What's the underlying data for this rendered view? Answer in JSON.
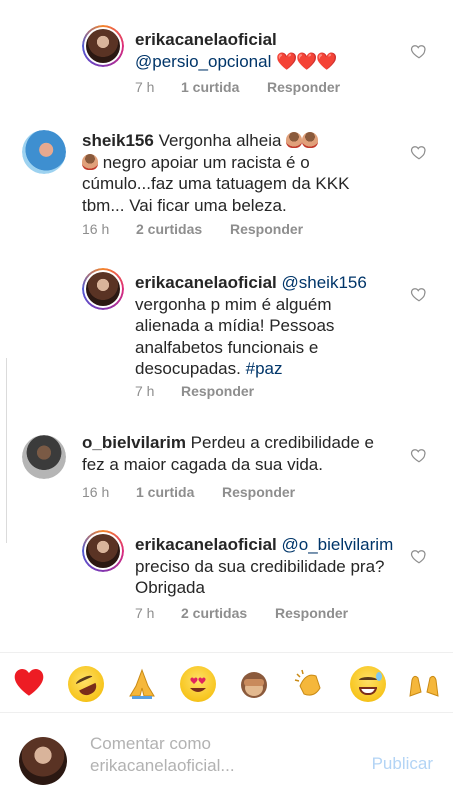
{
  "comments": [
    {
      "user": "erikacanelaoficial",
      "mention": "@persio_opcional",
      "hearts": "❤️❤️❤️",
      "time": "7 h",
      "likes": "1 curtida",
      "reply": "Responder"
    },
    {
      "user": "sheik156",
      "text_a": " Vergonha alheia ",
      "text_b": " negro apoiar um racista é o cúmulo...faz uma tatuagem da KKK tbm... Vai ficar uma beleza.",
      "time": "16 h",
      "likes": "2 curtidas",
      "reply": "Responder"
    },
    {
      "user": "erikacanelaoficial",
      "mention": "@sheik156",
      "text": "vergonha p mim é alguém alienada a mídia! Pessoas analfabetos funcionais e desocupadas.",
      "hashtag": "#paz",
      "time": "7 h",
      "reply": "Responder"
    },
    {
      "user": "o_bielvilarim",
      "text": " Perdeu a credibilidade e fez a maior cagada da sua vida.",
      "time": "16 h",
      "likes": "1 curtida",
      "reply": "Responder"
    },
    {
      "user": "erikacanelaoficial",
      "mention": "@o_bielvilarim",
      "text": "preciso da sua credibilidade pra? Obrigada",
      "time": "7 h",
      "likes": "2 curtidas",
      "reply": "Responder"
    }
  ],
  "emoji_bar": [
    "heart",
    "rolling-on-floor-laughing",
    "folded-hands",
    "heart-eyes",
    "see-no-evil-monkey",
    "clapping-hands",
    "grinning-sweat",
    "raising-hands"
  ],
  "input": {
    "placeholder": "Comentar como erikacanelaoficial...",
    "publish": "Publicar"
  },
  "colors": {
    "link": "#003569",
    "meta": "#8e8e8e",
    "publish_disabled": "#b3d4f5",
    "heart": "#ed1c24"
  }
}
